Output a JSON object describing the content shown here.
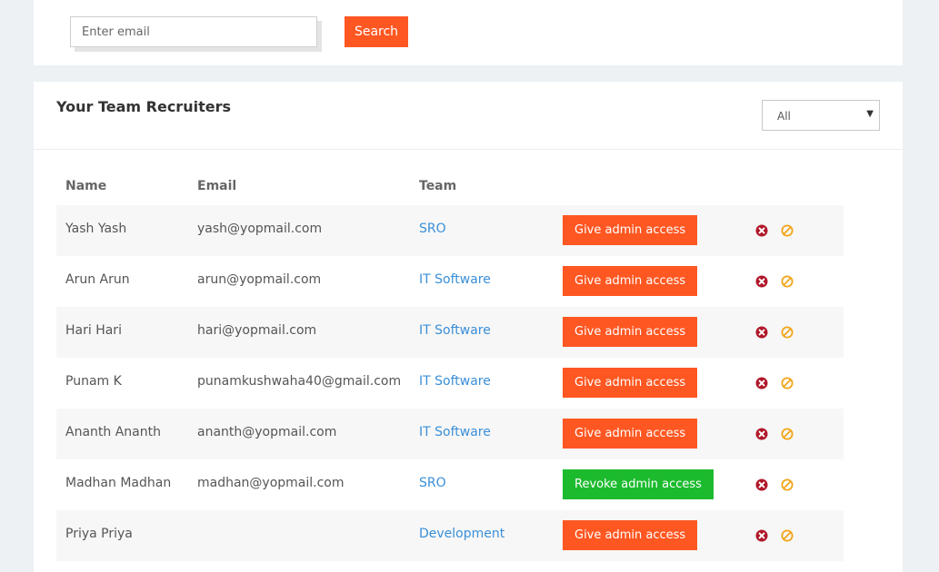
{
  "search": {
    "placeholder": "Enter email",
    "value": "",
    "button_label": "Search",
    "accent_color": "#ff5722"
  },
  "team": {
    "title": "Your Team Recruiters",
    "filter": {
      "selected": "All"
    },
    "columns": [
      "Name",
      "Email",
      "Team"
    ],
    "rows": [
      {
        "name": "Yash Yash",
        "email": "yash@yopmail.com",
        "team": "SRO",
        "action": "Give admin access",
        "action_type": "give"
      },
      {
        "name": "Arun Arun",
        "email": "arun@yopmail.com",
        "team": "IT Software",
        "action": "Give admin access",
        "action_type": "give"
      },
      {
        "name": "Hari Hari",
        "email": "hari@yopmail.com",
        "team": "IT Software",
        "action": "Give admin access",
        "action_type": "give"
      },
      {
        "name": "Punam K",
        "email": "punamkushwaha40@gmail.com",
        "team": "IT Software",
        "action": "Give admin access",
        "action_type": "give"
      },
      {
        "name": "Ananth Ananth",
        "email": "ananth@yopmail.com",
        "team": "IT Software",
        "action": "Give admin access",
        "action_type": "give"
      },
      {
        "name": "Madhan Madhan",
        "email": "madhan@yopmail.com",
        "team": "SRO",
        "action": "Revoke admin access",
        "action_type": "revoke"
      },
      {
        "name": "Priya Priya",
        "email": "",
        "team": "Development",
        "action": "Give admin access",
        "action_type": "give"
      }
    ],
    "row_icons": [
      "remove-icon",
      "block-icon"
    ],
    "colors": {
      "give_button": "#ff5722",
      "revoke_button": "#1cbb2e",
      "team_link": "#3a8fd8",
      "remove_icon": "#b0182a",
      "block_icon": "#f2a51a"
    }
  }
}
